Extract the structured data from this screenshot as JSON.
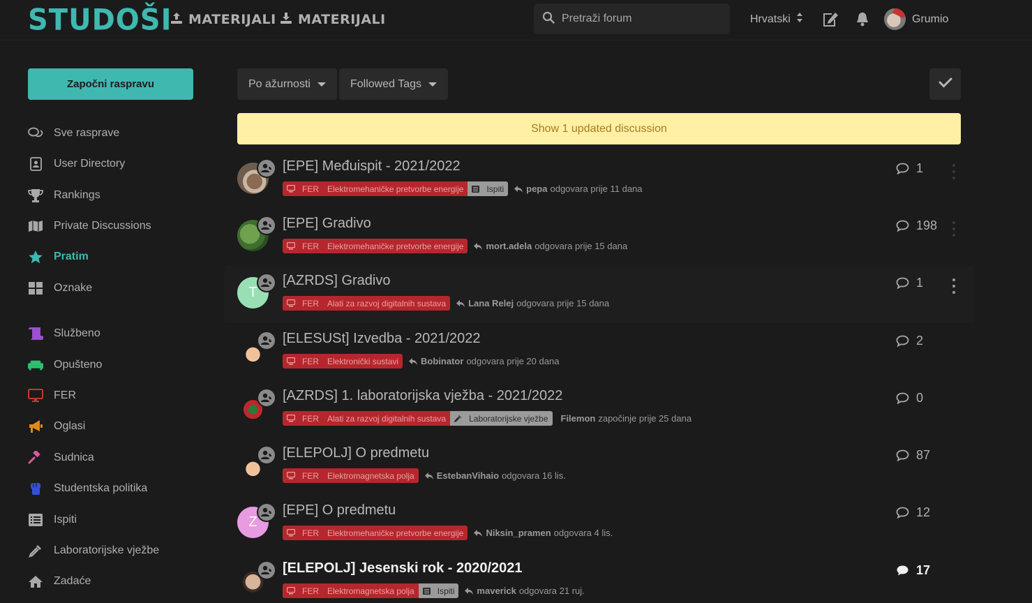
{
  "header": {
    "logo": "STUDOŠI",
    "upload_label": "MATERIJALI",
    "download_label": "MATERIJALI",
    "search_placeholder": "Pretraži forum",
    "language": "Hrvatski",
    "username": "Grumio"
  },
  "sidebar": {
    "start_button": "Započni raspravu",
    "items": [
      {
        "label": "Sve rasprave",
        "icon": "comments-icon",
        "color": "#a8a8a8"
      },
      {
        "label": "User Directory",
        "icon": "address-book-icon",
        "color": "#a8a8a8"
      },
      {
        "label": "Rankings",
        "icon": "trophy-icon",
        "color": "#a8a8a8"
      },
      {
        "label": "Private Discussions",
        "icon": "map-icon",
        "color": "#a8a8a8"
      },
      {
        "label": "Pratim",
        "icon": "star-icon",
        "color": "#3fb8b0"
      },
      {
        "label": "Oznake",
        "icon": "grid-icon",
        "color": "#a8a8a8"
      },
      {
        "label": "Službeno",
        "icon": "scroll-icon",
        "color": "#9b4fd1"
      },
      {
        "label": "Opušteno",
        "icon": "couch-icon",
        "color": "#2fbf6f"
      },
      {
        "label": "FER",
        "icon": "desktop-icon",
        "color": "#c0392b"
      },
      {
        "label": "Oglasi",
        "icon": "bullhorn-icon",
        "color": "#e08a1e"
      },
      {
        "label": "Sudnica",
        "icon": "gavel-icon",
        "color": "#d85aa0"
      },
      {
        "label": "Studentska politika",
        "icon": "fist-icon",
        "color": "#3350d8"
      },
      {
        "label": "Ispiti",
        "icon": "list-icon",
        "color": "#a8a8a8"
      },
      {
        "label": "Laboratorijske vježbe",
        "icon": "eyedropper-icon",
        "color": "#a8a8a8"
      },
      {
        "label": "Zadaće",
        "icon": "home-icon",
        "color": "#a8a8a8"
      }
    ]
  },
  "toolbar": {
    "sort_label": "Po ažurnosti",
    "filter_label": "Followed Tags"
  },
  "banner": "Show 1 updated discussion",
  "discussions": [
    {
      "title": "[EPE] Međuispit - 2021/2022",
      "tags": [
        "FER",
        "Elektromehaničke pretvorbe energije"
      ],
      "extra_tag": "Ispiti",
      "user": "pepa",
      "action": "odgovara prije 11 dana",
      "replies": "1",
      "avatar": "photo",
      "unread": false,
      "reply_icon": true
    },
    {
      "title": "[EPE] Gradivo",
      "tags": [
        "FER",
        "Elektromehaničke pretvorbe energije"
      ],
      "extra_tag": "",
      "user": "mort.adela",
      "action": "odgovara prije 15 dana",
      "replies": "198",
      "avatar": "frog",
      "unread": false,
      "reply_icon": true
    },
    {
      "title": "[AZRDS] Gradivo",
      "tags": [
        "FER",
        "Alati za razvoj digitalnih sustava"
      ],
      "extra_tag": "",
      "user": "Lana Relej",
      "action": "odgovara prije 15 dana",
      "replies": "1",
      "avatar": "T",
      "unread": false,
      "reply_icon": true
    },
    {
      "title": "[ELESUSt] Izvedba - 2021/2022",
      "tags": [
        "FER",
        "Elektronički sustavi"
      ],
      "extra_tag": "",
      "user": "Bobinator",
      "action": "odgovara prije 20 dana",
      "replies": "2",
      "avatar": "builder",
      "unread": false,
      "reply_icon": true
    },
    {
      "title": "[AZRDS] 1. laboratorijska vježba - 2021/2022",
      "tags": [
        "FER",
        "Alati za razvoj digitalnih sustava"
      ],
      "extra_tag": "Laboratorijske vježbe",
      "user": "Filemon",
      "action": "započinje prije 25 dana",
      "replies": "0",
      "avatar": "santa",
      "unread": false,
      "reply_icon": false
    },
    {
      "title": "[ELEPOLJ] O predmetu",
      "tags": [
        "FER",
        "Elektromagnetska polja"
      ],
      "extra_tag": "",
      "user": "EstebanVihaio",
      "action": "odgovara 16 lis.",
      "replies": "87",
      "avatar": "builder",
      "unread": false,
      "reply_icon": true
    },
    {
      "title": "[EPE] O predmetu",
      "tags": [
        "FER",
        "Elektromehaničke pretvorbe energije"
      ],
      "extra_tag": "",
      "user": "Niksin_pramen",
      "action": "odgovara 4 lis.",
      "replies": "12",
      "avatar": "Z",
      "unread": false,
      "reply_icon": true
    },
    {
      "title": "[ELEPOLJ] Jesenski rok - 2020/2021",
      "tags": [
        "FER",
        "Elektromagnetska polja"
      ],
      "extra_tag": "Ispiti",
      "user": "maverick",
      "action": "odgovara 21 ruj.",
      "replies": "17",
      "avatar": "face",
      "unread": true,
      "reply_icon": true
    }
  ]
}
